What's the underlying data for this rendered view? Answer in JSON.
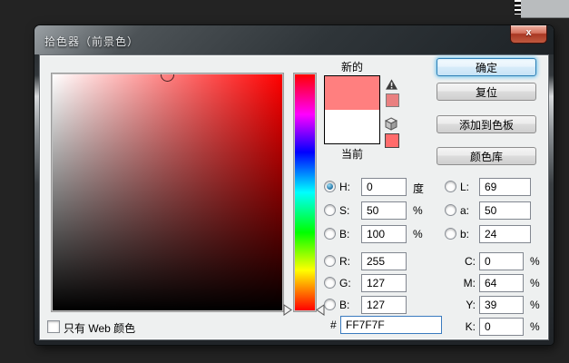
{
  "window": {
    "title": "拾色器（前景色）",
    "close_label": "x"
  },
  "swatches": {
    "new_label": "新的",
    "current_label": "当前",
    "new_color": "#FF7F7F",
    "current_color": "#FFFFFF",
    "gamut_proxy_color": "#E98080",
    "web_proxy_color": "#FF6B6B"
  },
  "buttons": {
    "ok": "确定",
    "reset": "复位",
    "add_to_swatches": "添加到色板",
    "color_libraries": "颜色库"
  },
  "fields": {
    "hsb": [
      {
        "label": "H:",
        "value": "0",
        "suffix": "度",
        "selected": true
      },
      {
        "label": "S:",
        "value": "50",
        "suffix": "%",
        "selected": false
      },
      {
        "label": "B:",
        "value": "100",
        "suffix": "%",
        "selected": false
      }
    ],
    "rgb": [
      {
        "label": "R:",
        "value": "255",
        "selected": false
      },
      {
        "label": "G:",
        "value": "127",
        "selected": false
      },
      {
        "label": "B:",
        "value": "127",
        "selected": false
      }
    ],
    "lab": [
      {
        "label": "L:",
        "value": "69",
        "selected": false
      },
      {
        "label": "a:",
        "value": "50",
        "selected": false
      },
      {
        "label": "b:",
        "value": "24",
        "selected": false
      }
    ],
    "cmyk": [
      {
        "label": "C:",
        "value": "0",
        "suffix": "%"
      },
      {
        "label": "M:",
        "value": "64",
        "suffix": "%"
      },
      {
        "label": "Y:",
        "value": "39",
        "suffix": "%"
      },
      {
        "label": "K:",
        "value": "0",
        "suffix": "%"
      }
    ],
    "hex": {
      "prefix": "#",
      "value": "FF7F7F"
    }
  },
  "web_only_checkbox": {
    "label": "只有 Web 颜色",
    "checked": false
  },
  "picker_state": {
    "hue_deg": 0,
    "saturation_pct": 50,
    "brightness_pct": 100
  }
}
